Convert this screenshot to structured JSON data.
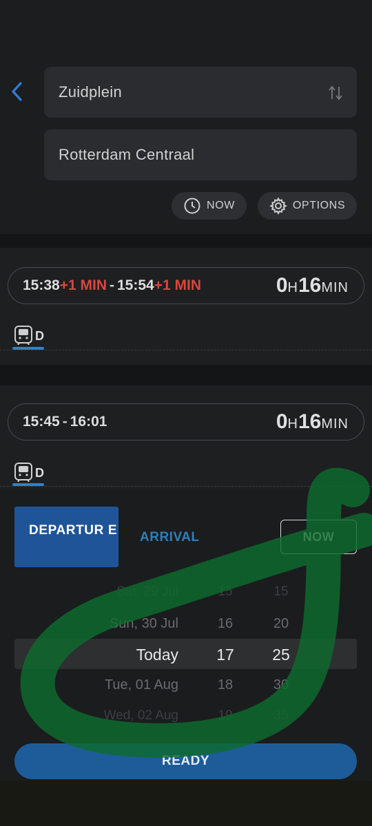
{
  "search": {
    "origin": "Zuidplein",
    "destination": "Rotterdam Centraal",
    "now_label": "NOW",
    "options_label": "OPTIONS"
  },
  "trips": [
    {
      "depart": "15:38",
      "depart_delay": "+1 MIN",
      "arrive": "15:54",
      "arrive_delay": "+1 MIN",
      "dur_h": "0",
      "dur_h_unit": "H",
      "dur_m": "16",
      "dur_m_unit": "MIN",
      "mode_label": "D"
    },
    {
      "depart": "15:45",
      "arrive": "16:01",
      "dur_h": "0",
      "dur_h_unit": "H",
      "dur_m": "16",
      "dur_m_unit": "MIN",
      "mode_label": "D"
    }
  ],
  "picker": {
    "departure_label": "DEPARTUR E",
    "arrival_label": "ARRIVAL",
    "now_label": "NOW",
    "rows": [
      {
        "date": "Sat, 29 Jul",
        "hour": "15",
        "minute": "15"
      },
      {
        "date": "Sun, 30 Jul",
        "hour": "16",
        "minute": "20"
      },
      {
        "date": "Today",
        "hour": "17",
        "minute": "25"
      },
      {
        "date": "Tue, 01 Aug",
        "hour": "18",
        "minute": "30"
      },
      {
        "date": "Wed, 02 Aug",
        "hour": "19",
        "minute": "35"
      }
    ],
    "ready_label": "READY"
  },
  "colors": {
    "accent_blue": "#2f7fd8",
    "delay_red": "#d9473f",
    "button_blue": "#1f5598",
    "overlay_green": "#0e6b2e"
  },
  "icons": [
    "back-arrow-icon",
    "swap-icon",
    "clock-icon",
    "gear-icon",
    "train-icon"
  ]
}
